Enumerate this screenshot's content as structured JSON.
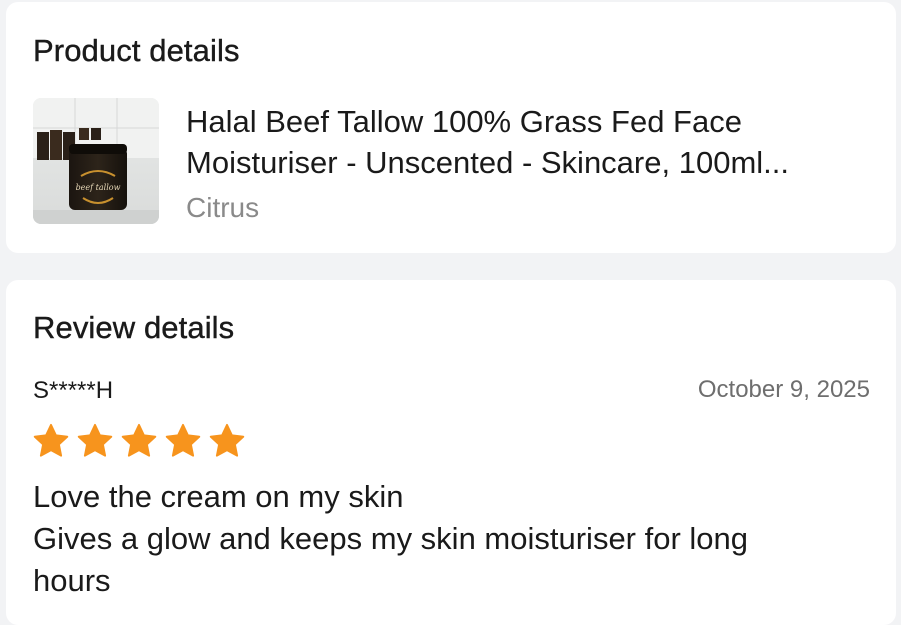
{
  "product_section": {
    "title": "Product details",
    "product": {
      "name_line1": "Halal Beef Tallow 100% Grass Fed Face",
      "name_line2": "Moisturiser - Unscented - Skincare, 100ml...",
      "seller": "Citrus",
      "thumbnail_label": "beef tallow"
    }
  },
  "review_section": {
    "title": "Review details",
    "reviewer": "S*****H",
    "date": "October 9, 2025",
    "rating": 5,
    "rating_max": 5,
    "star_color": "#f7941d",
    "text_line1": "Love the cream on my skin",
    "text_line2": "Gives a glow and keeps my skin moisturiser for long",
    "text_line3": "hours"
  }
}
